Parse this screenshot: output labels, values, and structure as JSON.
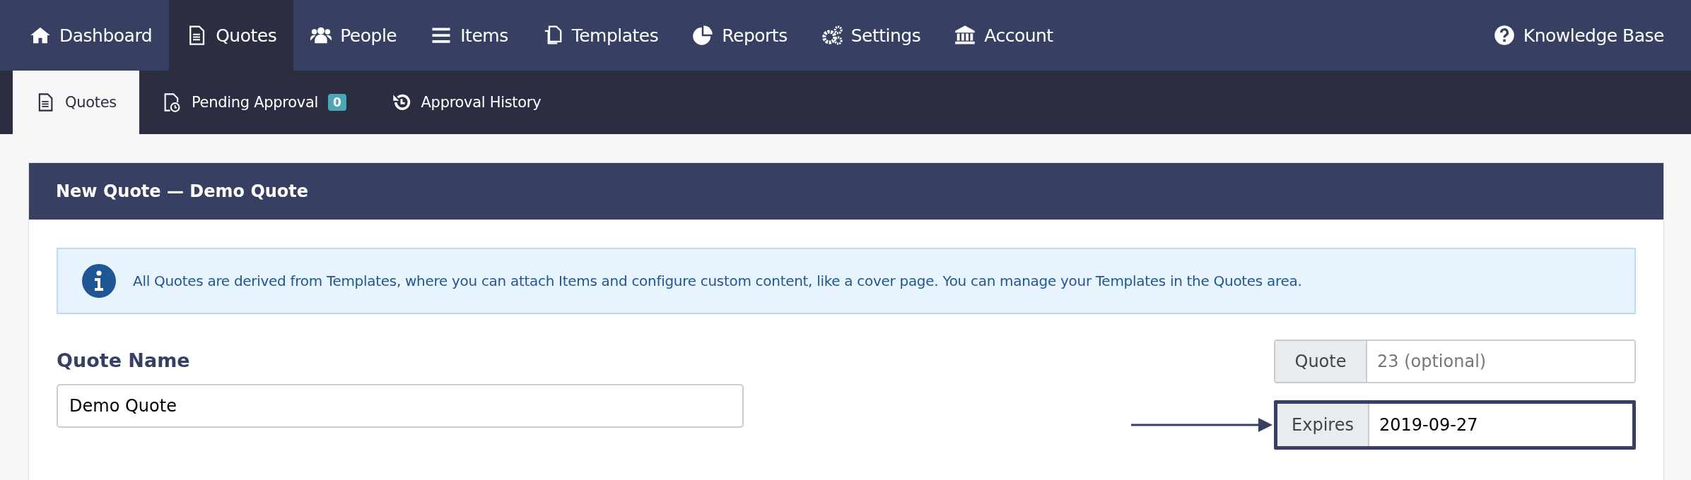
{
  "nav": {
    "items": [
      {
        "label": "Dashboard",
        "selected": false
      },
      {
        "label": "Quotes",
        "selected": true
      },
      {
        "label": "People",
        "selected": false
      },
      {
        "label": "Items",
        "selected": false
      },
      {
        "label": "Templates",
        "selected": false
      },
      {
        "label": "Reports",
        "selected": false
      },
      {
        "label": "Settings",
        "selected": false
      },
      {
        "label": "Account",
        "selected": false
      }
    ],
    "help": {
      "label": "Knowledge Base"
    }
  },
  "subnav": {
    "tabs": [
      {
        "label": "Quotes",
        "selected": true
      },
      {
        "label": "Pending Approval",
        "selected": false,
        "badge": "0"
      },
      {
        "label": "Approval History",
        "selected": false
      }
    ]
  },
  "card": {
    "title": "New Quote — Demo Quote",
    "info": "All Quotes are derived from Templates, where you can attach Items and configure custom content, like a cover page. You can manage your Templates in the Quotes area.",
    "quote_name": {
      "label": "Quote Name",
      "value": "Demo Quote"
    },
    "fields": [
      {
        "label": "Quote",
        "placeholder": "23 (optional)",
        "highlighted": false
      },
      {
        "label": "Expires",
        "value": "2019-09-27",
        "highlighted": true
      }
    ]
  }
}
